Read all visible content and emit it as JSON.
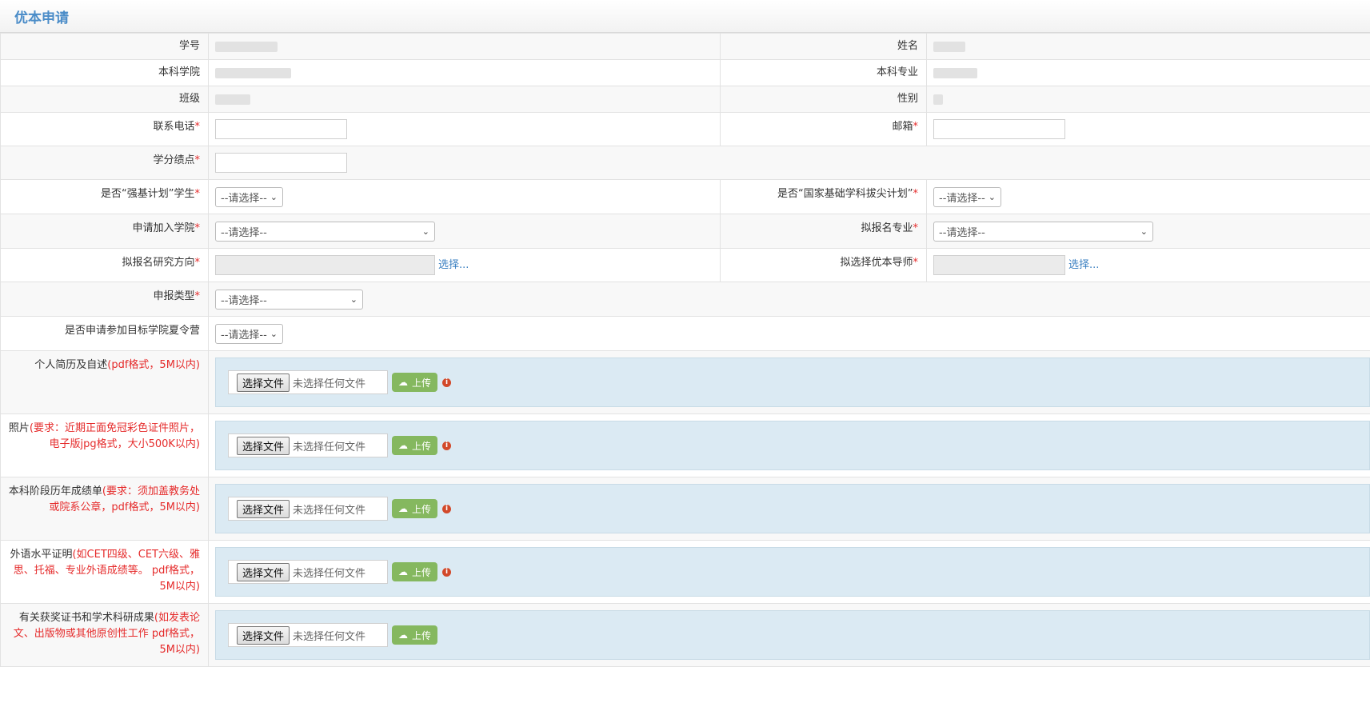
{
  "header": {
    "title": "优本申请"
  },
  "fields": {
    "xuehao": "学号",
    "xingming": "姓名",
    "xueyuan": "本科学院",
    "zhuanye": "本科专业",
    "banji": "班级",
    "xingbie": "性别",
    "dianhua": "联系电话",
    "youxiang": "邮箱",
    "jidian": "学分绩点",
    "qiangji": "是否“强基计划”学生",
    "guojia": "是否“国家基础学科拔尖计划”",
    "jiaru": "申请加入学院",
    "nibaoming": "拟报名专业",
    "fangxiang": "拟报名研究方向",
    "daoshi": "拟选择优本导师",
    "leixing": "申报类型",
    "xialingying": "是否申请参加目标学院夏令营"
  },
  "required_mark": "*",
  "select_placeholder": "--请选择--",
  "choose_link": "选择...",
  "uploads": [
    {
      "label": "个人简历及自述",
      "note": "(pdf格式，5M以内)"
    },
    {
      "label": "照片",
      "note": "(要求：近期正面免冠彩色证件照片，电子版jpg格式，大小500K以内)"
    },
    {
      "label": "本科阶段历年成绩单",
      "note": "(要求：须加盖教务处或院系公章，pdf格式，5M以内)"
    },
    {
      "label": "外语水平证明",
      "note": "(如CET四级、CET六级、雅思、托福、专业外语成绩等。 pdf格式，5M以内)"
    },
    {
      "label": "有关获奖证书和学术科研成果",
      "note": "(如发表论文、出版物或其他原创性工作 pdf格式，5M以内)"
    }
  ],
  "file_button": "选择文件",
  "file_none": "未选择任何文件",
  "upload_button": "上传",
  "icons": {
    "upload": "cloud-upload-icon",
    "info": "info-icon",
    "chevron": "chevron-down-icon"
  },
  "colors": {
    "required": "#e52b2b",
    "link": "#3a7fc1",
    "upload_bg": "#dbeaf3",
    "upload_btn": "#85b85f",
    "title": "#4a8cc8"
  }
}
